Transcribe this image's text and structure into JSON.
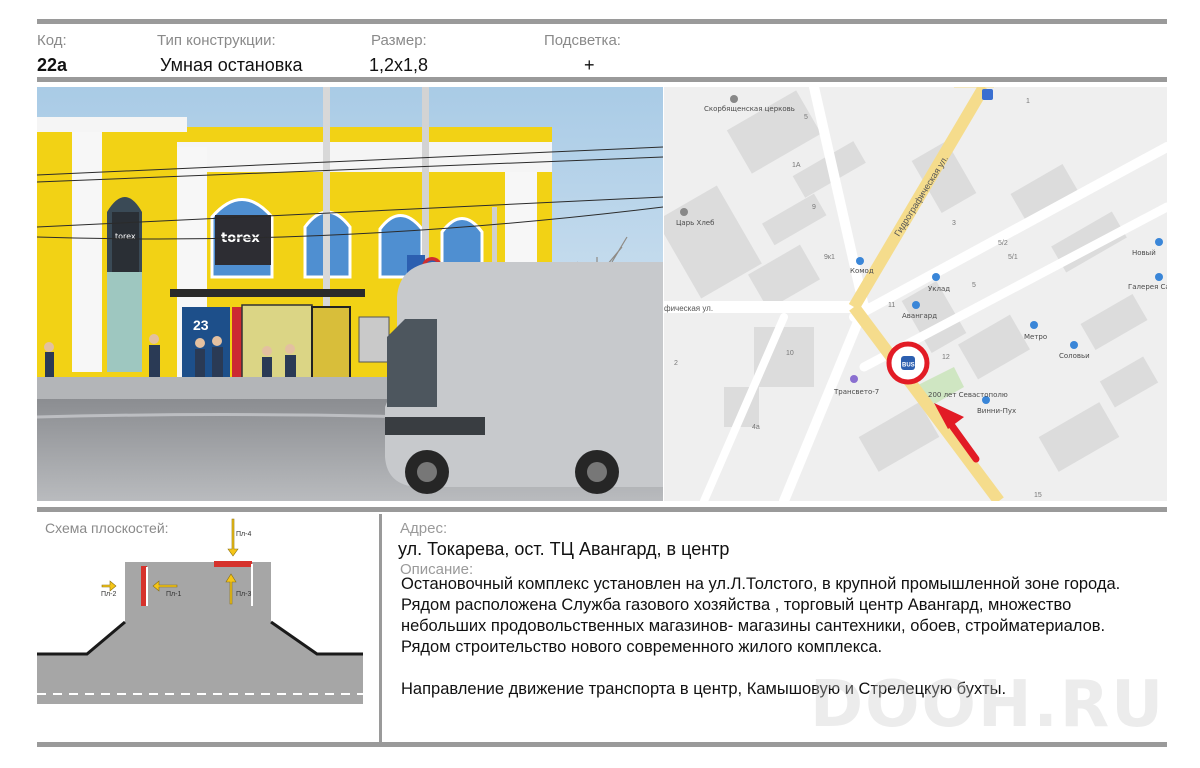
{
  "header": {
    "code_label": "Код:",
    "type_label": "Тип конструкции:",
    "size_label": "Размер:",
    "light_label": "Подсветка:",
    "code": "22а",
    "type": "Умная остановка",
    "size": "1,2х1,8",
    "light": "+"
  },
  "photo": {
    "store_sign": "torex",
    "board_number": "23"
  },
  "map": {
    "streets": [
      "Гидрографическая ул.",
      "фическая ул."
    ],
    "places": [
      "Скорбященская церковь",
      "Царь Хлеб",
      "Комод",
      "Уклад",
      "Авангард",
      "Метро",
      "Соловьи",
      "Трансвето-7",
      "Винни-Пух",
      "Новый",
      "Галерея Саквояж",
      "200 лет Севастополю"
    ],
    "buildings": [
      "1",
      "5",
      "1А",
      "9",
      "9к1",
      "3",
      "5/2",
      "5/1",
      "5",
      "11",
      "12",
      "10",
      "2",
      "4а",
      "15"
    ],
    "marker_label": "BUS"
  },
  "scheme": {
    "title": "Схема плоскостей:",
    "planes": [
      "Пл-1",
      "Пл-2",
      "Пл-3",
      "Пл-4"
    ]
  },
  "info": {
    "address_label": "Адрес:",
    "address": "ул. Токарева, ост. ТЦ Авангард, в центр",
    "description_label": "Описание:",
    "description": [
      "Остановочный комплекс установлен на ул.Л.Толстого, в крупной промышленной зоне города.",
      "Рядом расположена Служба газового хозяйства , торговый центр Авангард,  множество",
      "небольших продовольственных магазинов- магазины сантехники, обоев, стройматериалов.",
      "Рядом  строительство нового  современного  жилого комплекса."
    ],
    "direction": "Направление движение транспорта в центр, Камышовую и Стрелецкую  бухты."
  },
  "watermark": "DOOH.RU",
  "colors": {
    "rule": "#9a9a9a",
    "building_yellow": "#f2d215",
    "plane_red": "#d6322c",
    "arrow_yellow": "#f5c518",
    "map_marker": "#e21b25",
    "road_gray": "#a6a6a6"
  }
}
